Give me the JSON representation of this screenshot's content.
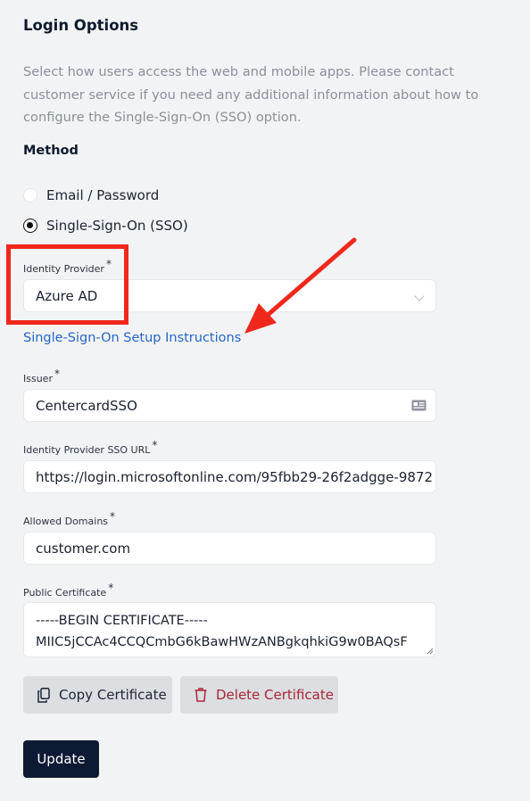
{
  "section": {
    "title": "Login Options",
    "description": "Select how users access the web and mobile apps. Please contact customer service if you need any additional information about how to configure the Single-Sign-On (SSO) option."
  },
  "method": {
    "label": "Method",
    "options": [
      {
        "label": "Email / Password",
        "selected": false
      },
      {
        "label": "Single-Sign-On (SSO)",
        "selected": true
      }
    ]
  },
  "identity_provider": {
    "label": "Identity Provider",
    "required_mark": "*",
    "value": "Azure AD"
  },
  "setup_link": "Single-Sign-On Setup Instructions",
  "issuer": {
    "label": "Issuer",
    "required_mark": "*",
    "value": "CentercardSSO"
  },
  "sso_url": {
    "label": "Identity Provider SSO URL",
    "required_mark": "*",
    "value": "https://login.microsoftonline.com/95fbb29-26f2adgge-9872"
  },
  "allowed_domains": {
    "label": "Allowed Domains",
    "required_mark": "*",
    "value": "customer.com"
  },
  "public_certificate": {
    "label": "Public Certificate",
    "required_mark": "*",
    "line1": "-----BEGIN CERTIFICATE-----",
    "line2": "MIIC5jCCAc4CCQCmbG6kBawHWzANBgkqhkiG9w0BAQsF"
  },
  "buttons": {
    "copy": "Copy Certificate",
    "delete": "Delete Certificate",
    "update": "Update"
  },
  "colors": {
    "annotation_red": "#f0281c",
    "link_blue": "#2566c8",
    "primary_navy": "#0d1a33",
    "danger_red": "#a8263a"
  }
}
